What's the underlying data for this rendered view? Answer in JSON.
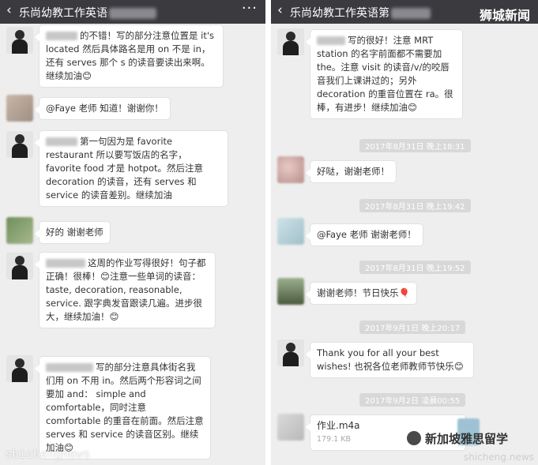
{
  "left": {
    "title": "乐尚幼教工作英语",
    "more": "···",
    "messages": [
      {
        "name_tail": "的不错！",
        "text": "写的部分注意位置是 it's located 然后具体路名是用 on 不是 in，还有 serves 那个 s 的读音要读出来啊。继续加油😊"
      },
      {
        "text": "@Faye 老师 知道！谢谢你！"
      },
      {
        "text": "第一句因为是 favorite restaurant 所以要写饭店的名字，favorite food 才是 hotpot。然后注意 decoration 的读音，还有 serves 和 service 的读音差别。继续加油"
      },
      {
        "text": "好的 谢谢老师"
      },
      {
        "text": "这周的作业写得很好！句子都正确！很棒！😊注意一些单词的读音：taste, decoration, reasonable, service. 跟字典发音跟读几遍。进步很大，继续加油！😊"
      },
      {
        "text": "写的部分注意具体街名我们用 on 不用 in。然后两个形容词之间要加 and： simple and comfortable，同时注意 comfortable 的重音在前面。然后注意 serves 和 service 的读音区别。继续加油😊"
      }
    ],
    "watermark": "shichengnews"
  },
  "right": {
    "title": "乐尚幼教工作英语第",
    "brand": "狮城新闻",
    "messages": [
      {
        "text": "写的很好！注意 MRT station 的名字前面都不需要加 the。注意 visit 的读音/v/的咬唇音我们上课讲过的；另外 decoration 的重音位置在 ra。很棒，有进步！继续加油😊"
      },
      {
        "ts": "2017年8月31日 晚上18:31"
      },
      {
        "text": "好哒，谢谢老师！"
      },
      {
        "ts": "2017年8月31日 晚上19:42"
      },
      {
        "text": "@Faye 老师 谢谢老师！"
      },
      {
        "ts": "2017年8月31日 晚上19:52"
      },
      {
        "text": "谢谢老师！节日快乐🎈"
      },
      {
        "ts": "2017年9月1日 晚上20:17"
      },
      {
        "text": "Thank you for all your best wishes! 也祝各位老师教师节快乐😊"
      },
      {
        "ts": "2017年9月2日 凌晨00:55"
      },
      {
        "file_name": "作业.m4a",
        "file_size": "179.1 KB"
      }
    ],
    "logo_text": "新加坡雅思留学",
    "watermark": "shicheng.news"
  }
}
